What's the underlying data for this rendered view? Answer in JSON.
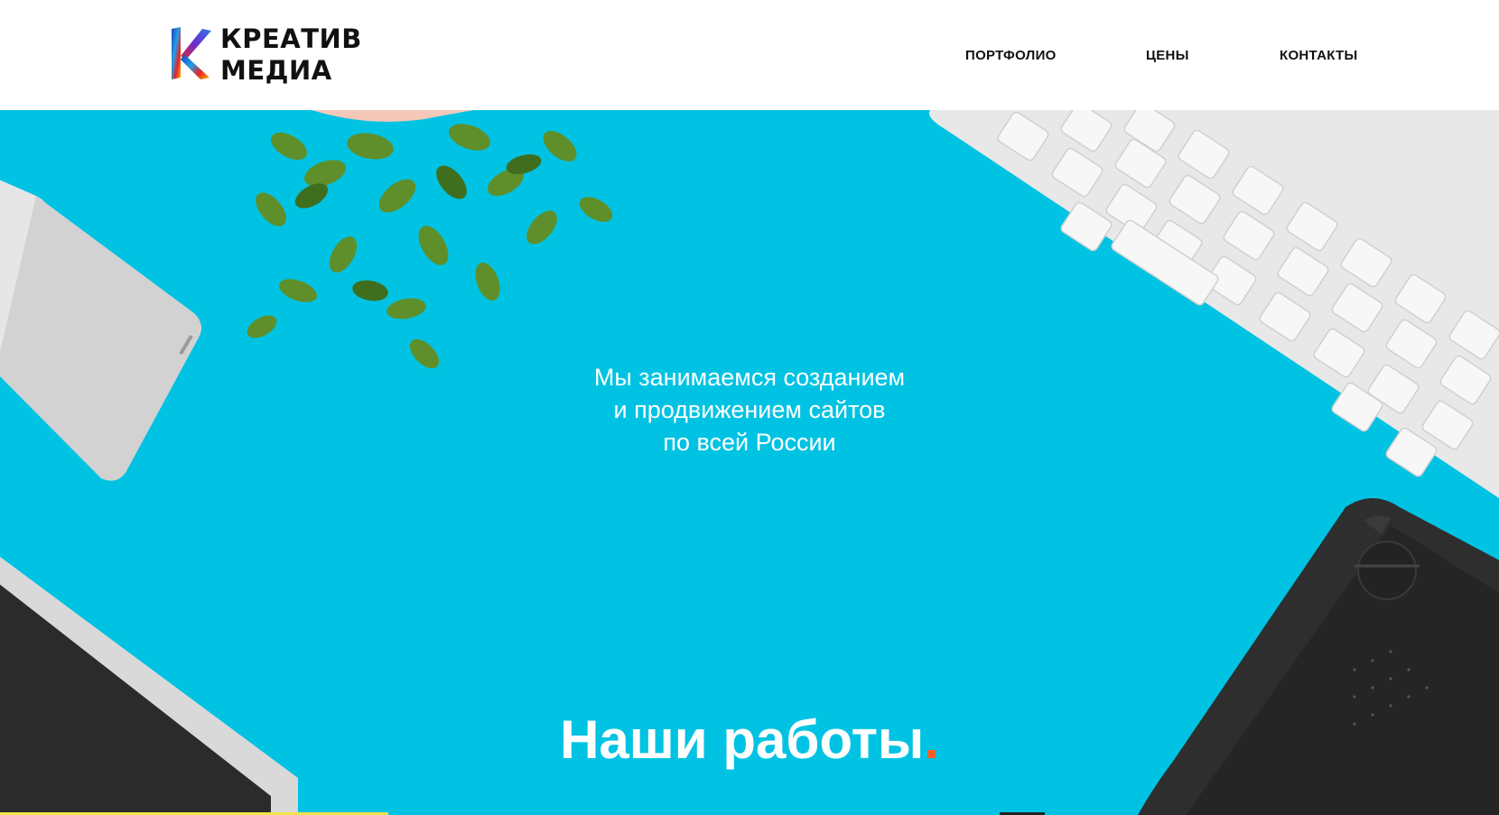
{
  "brand": {
    "logo_line1": "КРЕАТИВ",
    "logo_line2": "МЕДИА",
    "logo_icon": "k-letter-logo-icon"
  },
  "nav": {
    "items": [
      {
        "label": "ПОРТФОЛИО"
      },
      {
        "label": "ЦЕНЫ"
      },
      {
        "label": "КОНТАКТЫ"
      }
    ]
  },
  "hero": {
    "tagline_lines": [
      "Мы занимаемся созданием",
      "и продвижением сайтов",
      "по всей России"
    ],
    "section_title": "Наши работы",
    "section_title_dot": "."
  },
  "colors": {
    "hero_background": "#00c3e3",
    "accent_dot": "#ff5a1f",
    "text_dark": "#111111",
    "text_light": "#ffffff"
  }
}
